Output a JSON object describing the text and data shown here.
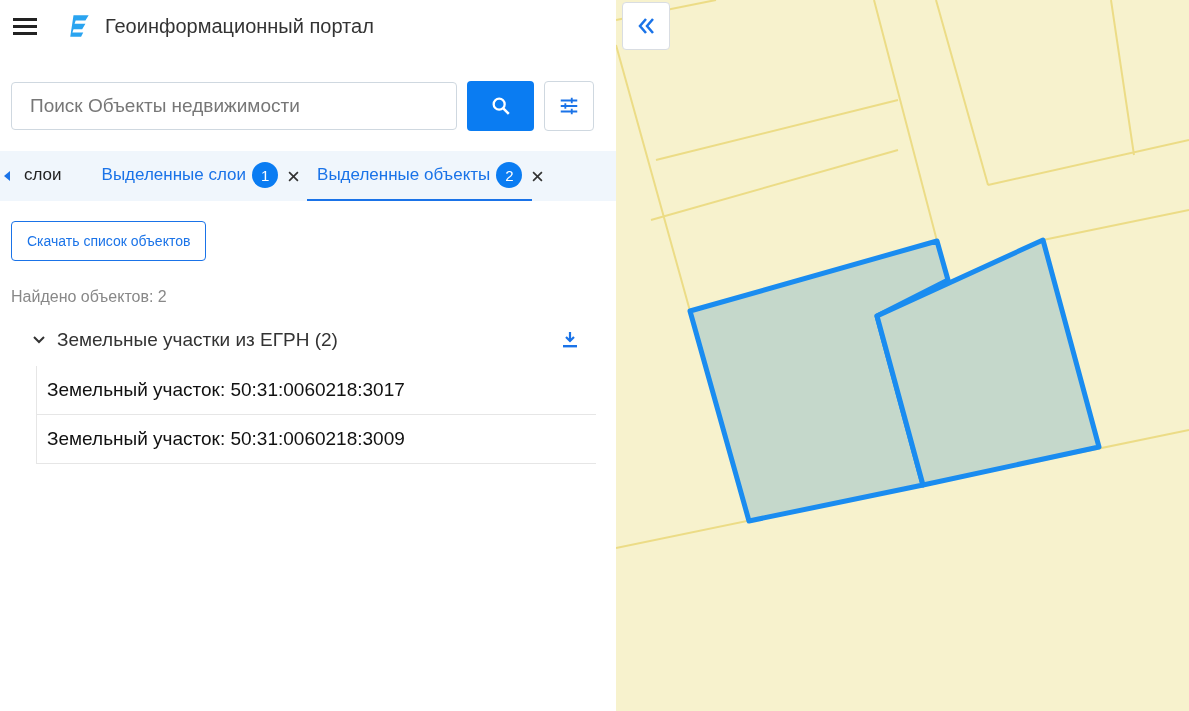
{
  "header": {
    "title": "Геоинформационный портал"
  },
  "search": {
    "placeholder": "Поиск Объекты недвижимости"
  },
  "tabs": [
    {
      "label": "слои",
      "selected": false,
      "closable": false
    },
    {
      "label": "Выделенные слои",
      "selected": false,
      "count": "1",
      "closable": true
    },
    {
      "label": "Выделенные объекты",
      "selected": true,
      "count": "2",
      "closable": true
    }
  ],
  "download_list_button": "Скачать список объектов",
  "found_count": "Найдено объектов: 2",
  "groups": [
    {
      "title": "Земельные участки из ЕГРН (2)",
      "expanded": true,
      "items": [
        "Земельный участок: 50:31:0060218:3017",
        "Земельный участок: 50:31:0060218:3009"
      ]
    }
  ]
}
